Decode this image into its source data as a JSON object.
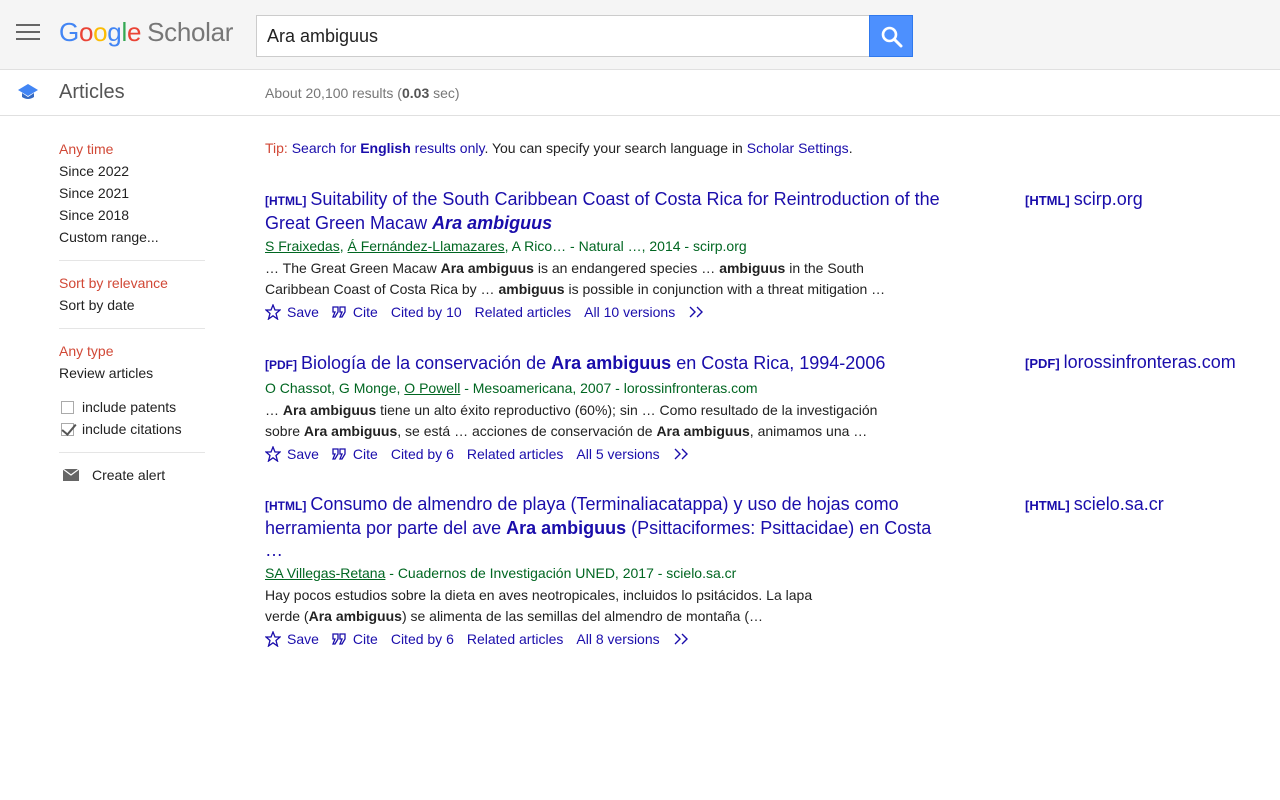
{
  "header": {
    "logo_letters": [
      "G",
      "o",
      "o",
      "g",
      "l",
      "e"
    ],
    "logo_product": "Scholar",
    "search_value": "Ara ambiguus"
  },
  "subheader": {
    "section": "Articles",
    "count_prefix": "About 20,100 results (",
    "count_time": "0.03",
    "count_suffix": " sec)"
  },
  "sidebar": {
    "time": [
      "Any time",
      "Since 2022",
      "Since 2021",
      "Since 2018",
      "Custom range..."
    ],
    "sort": [
      "Sort by relevance",
      "Sort by date"
    ],
    "type": [
      "Any type",
      "Review articles"
    ],
    "include_patents": "include patents",
    "include_citations": "include citations",
    "create_alert": "Create alert"
  },
  "tip": {
    "label": "Tip:",
    "link1_pre": "Search for ",
    "link1_bold": "English",
    "link1_post": " results only",
    "mid": ". You can specify your search language in ",
    "link2": "Scholar Settings",
    "end": "."
  },
  "results": [
    {
      "tag": "[HTML]",
      "title_a": "Suitability of the South Caribbean Coast of Costa Rica for Reintroduction of the Great Green Macaw ",
      "title_b": "Ara ambiguus",
      "authors": [
        "S Fraixedas",
        "Á Fernández-Llamazares"
      ],
      "meta_rest": ", A Rico… - Natural …, 2014 - scirp.org",
      "snip": [
        "… The Great Green Macaw ",
        "Ara ambiguus",
        " is an endangered species … ",
        "ambiguus",
        " in the South Caribbean Coast of Costa Rica by … ",
        "ambiguus",
        " is possible in conjunction with a threat mitigation …"
      ],
      "cited": "Cited by 10",
      "versions": "All 10 versions",
      "side_tag": "[HTML]",
      "side_domain": "scirp.org"
    },
    {
      "tag": "[PDF]",
      "title_a": "Biología de la conservación de ",
      "title_b": "Ara ambiguus",
      "title_c": " en Costa Rica, 1994-2006",
      "authors": [
        "O Powell"
      ],
      "meta_pre": "O Chassot, G Monge, ",
      "meta_rest": " - Mesoamericana, 2007 - lorossinfronteras.com",
      "snip": [
        "… ",
        "Ara ambiguus",
        " tiene un alto éxito reproductivo (60%); sin … Como resultado de la investigación sobre ",
        "Ara ambiguus",
        ", se está … acciones de conservación de ",
        "Ara ambiguus",
        ", animamos una …"
      ],
      "cited": "Cited by 6",
      "versions": "All 5 versions",
      "side_tag": "[PDF]",
      "side_domain": "lorossinfronteras.com"
    },
    {
      "tag": "[HTML]",
      "title_a": "Consumo de almendro de playa (Terminaliacatappa) y uso de hojas como herramienta por parte del ave ",
      "title_b": "Ara ambiguus",
      "title_c": " (Psittaciformes: Psittacidae) en Costa …",
      "authors": [
        "SA Villegas-Retana"
      ],
      "meta_rest": " - Cuadernos de Investigación UNED, 2017 - scielo.sa.cr",
      "snip": [
        "Hay pocos estudios sobre la dieta en aves neotropicales, incluidos lo psitácidos. La lapa verde (",
        "Ara ambiguus",
        ") se alimenta de las semillas del almendro de montaña (…"
      ],
      "cited": "Cited by 6",
      "versions": "All 8 versions",
      "side_tag": "[HTML]",
      "side_domain": "scielo.sa.cr"
    }
  ],
  "actions": {
    "save": "Save",
    "cite": "Cite",
    "related": "Related articles"
  },
  "icons": {
    "menu": "hamburger-icon",
    "search": "magnifier-icon",
    "cap": "graduation-cap-icon",
    "alert": "envelope-icon",
    "save": "star-icon",
    "cite": "quote-icon",
    "more": "double-chevron-icon"
  }
}
